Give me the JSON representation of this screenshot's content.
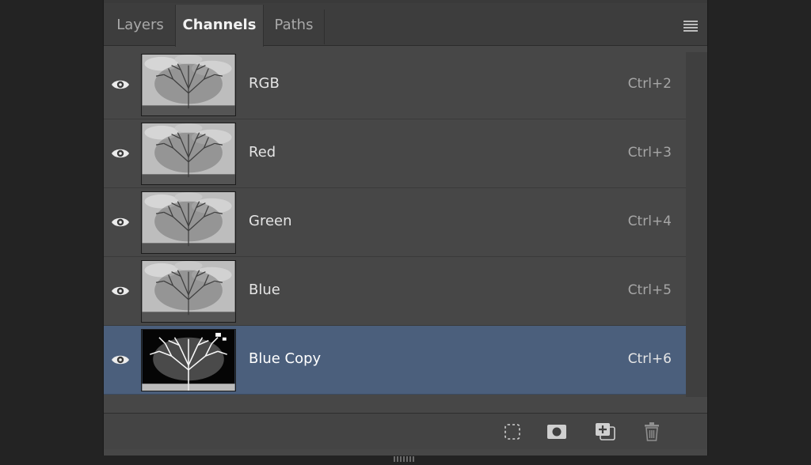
{
  "tabs": [
    {
      "label": "Layers",
      "active": false
    },
    {
      "label": "Channels",
      "active": true
    },
    {
      "label": "Paths",
      "active": false
    }
  ],
  "panel_menu_icon": "hamburger-menu-icon",
  "channels": [
    {
      "name": "RGB",
      "shortcut": "Ctrl+2",
      "visible": true,
      "selected": false,
      "thumbnail": "tree-grayscale"
    },
    {
      "name": "Red",
      "shortcut": "Ctrl+3",
      "visible": true,
      "selected": false,
      "thumbnail": "tree-grayscale"
    },
    {
      "name": "Green",
      "shortcut": "Ctrl+4",
      "visible": true,
      "selected": false,
      "thumbnail": "tree-grayscale"
    },
    {
      "name": "Blue",
      "shortcut": "Ctrl+5",
      "visible": true,
      "selected": false,
      "thumbnail": "tree-grayscale"
    },
    {
      "name": "Blue Copy",
      "shortcut": "Ctrl+6",
      "visible": true,
      "selected": true,
      "thumbnail": "tree-inverted-mask"
    }
  ],
  "footer_buttons": [
    {
      "icon": "load-channel-as-selection-icon"
    },
    {
      "icon": "save-selection-as-channel-icon"
    },
    {
      "icon": "create-new-channel-icon"
    },
    {
      "icon": "delete-channel-icon"
    }
  ],
  "colors": {
    "background": "#232323",
    "panel": "#474747",
    "selected_row": "#4b5f7c",
    "text": "#e4e4e4",
    "shortcut_text": "#a6a6a6"
  }
}
